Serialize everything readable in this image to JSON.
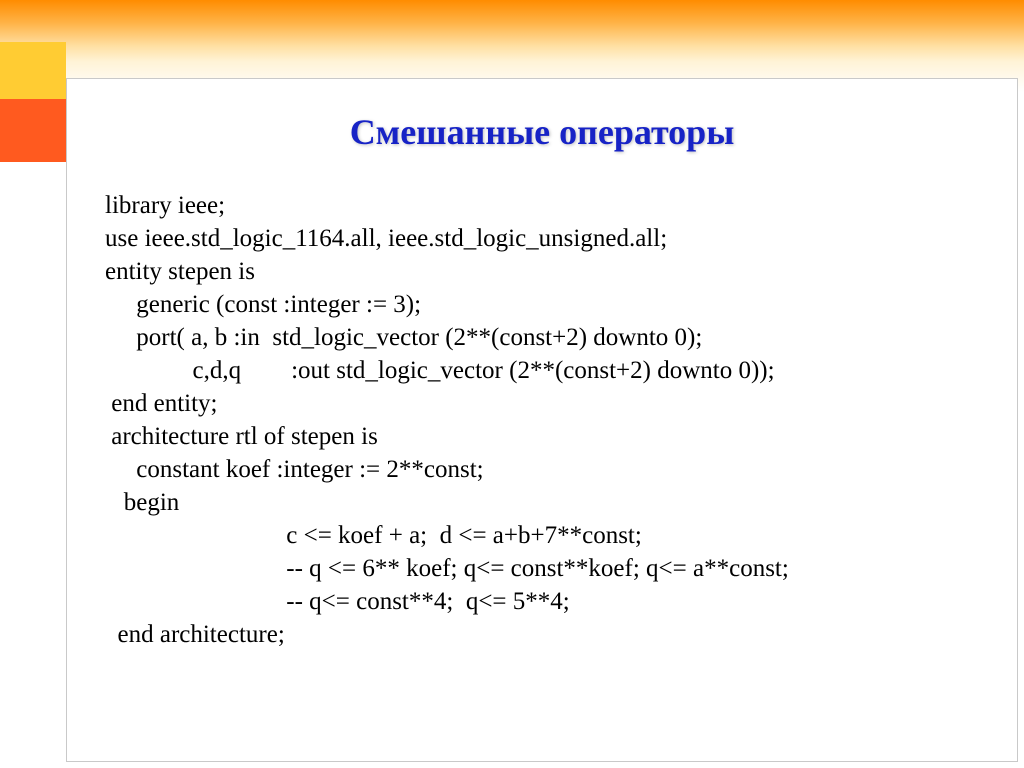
{
  "title": "Смешанные операторы",
  "code": {
    "l1": "library ieee;",
    "l2": "use ieee.std_logic_1164.all, ieee.std_logic_unsigned.all;",
    "l3": "entity stepen is",
    "l4": "     generic (const :integer := 3);",
    "l5": "     port( a, b :in  std_logic_vector (2**(const+2) downto 0);",
    "l6": "              c,d,q        :out std_logic_vector (2**(const+2) downto 0));",
    "l7": " end entity;",
    "l8": " architecture rtl of stepen is",
    "l9": "     constant koef :integer := 2**const;",
    "l10": "   begin",
    "l11": "                             c <= koef + a;  d <= a+b+7**const;",
    "l12": "                             -- q <= 6** koef; q<= const**koef; q<= a**const;",
    "l13": "                             -- q<= const**4;  q<= 5**4;",
    "l14": "  end architecture;"
  }
}
